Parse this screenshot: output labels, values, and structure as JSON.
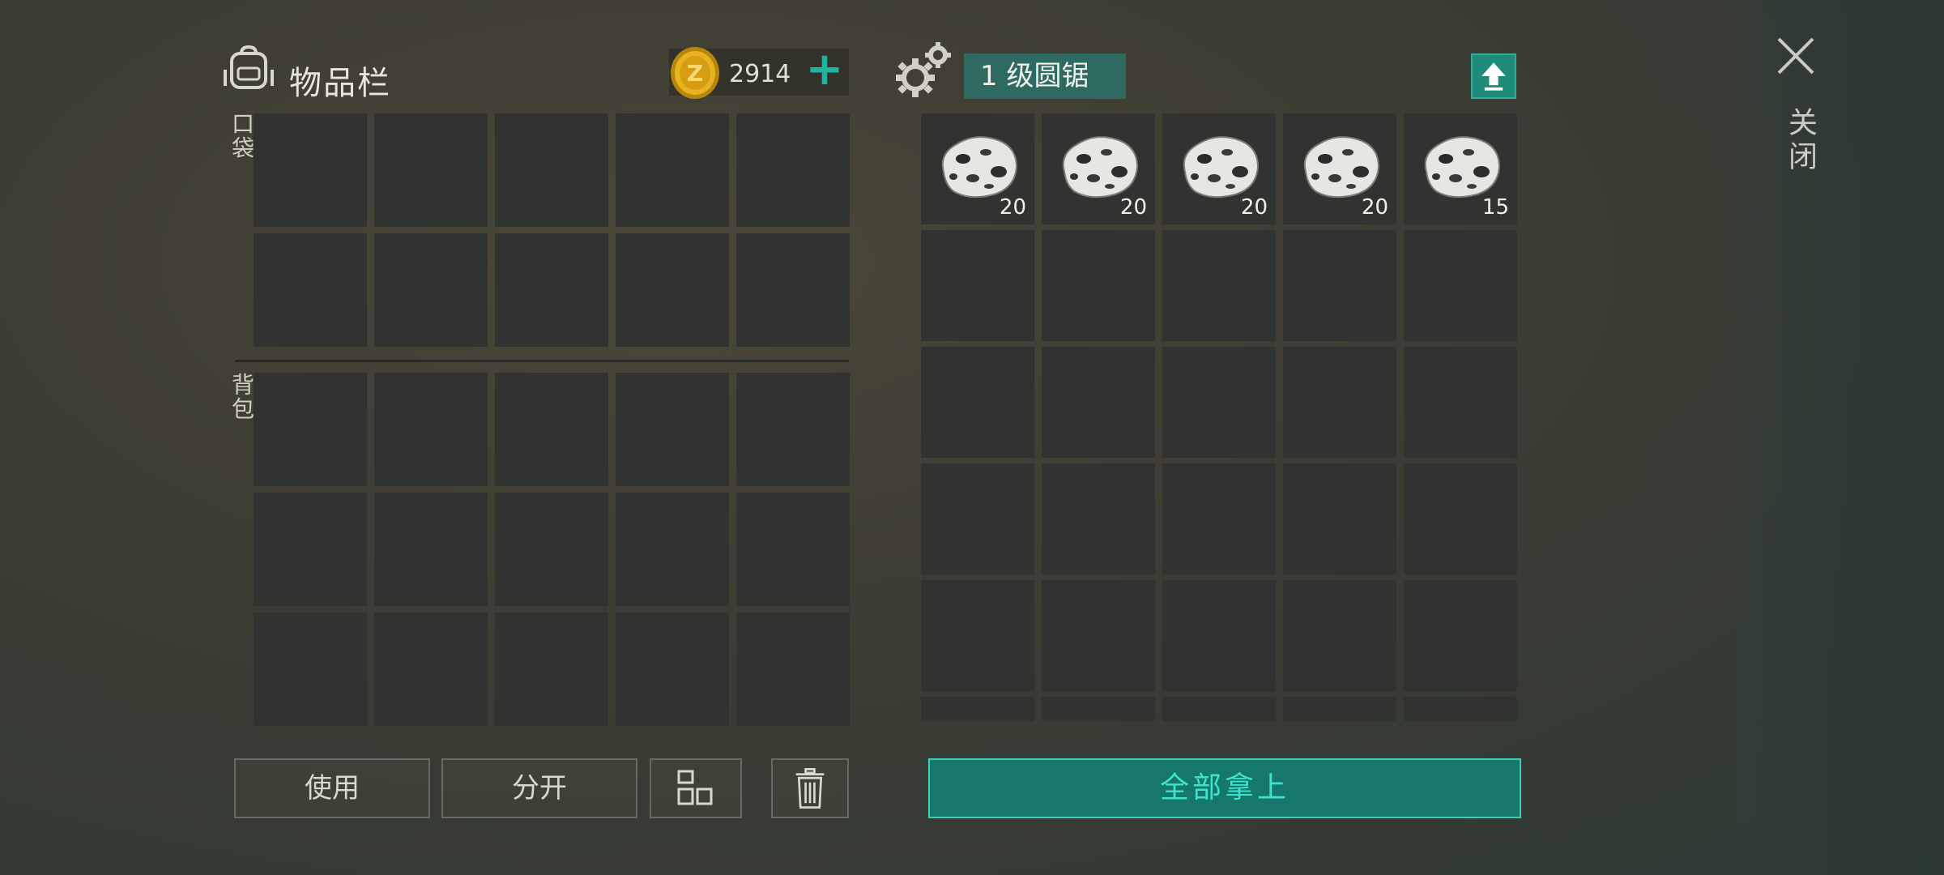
{
  "inventory": {
    "title": "物品栏",
    "coins": "2914",
    "plus_label": "+",
    "pocket_label": "口袋",
    "backpack_label": "背包"
  },
  "station": {
    "title": "1 级圆锯",
    "items": [
      {
        "name": "stone",
        "qty": "20"
      },
      {
        "name": "stone",
        "qty": "20"
      },
      {
        "name": "stone",
        "qty": "20"
      },
      {
        "name": "stone",
        "qty": "20"
      },
      {
        "name": "stone",
        "qty": "15"
      }
    ]
  },
  "buttons": {
    "use": "使用",
    "split": "分开",
    "take_all": "全部拿上",
    "close": "关闭"
  },
  "icons": {
    "bag": "backpack-icon",
    "coin": "coin-icon",
    "gears": "gears-icon",
    "upgrade": "arrow-up-icon",
    "sort": "sort-grid-icon",
    "trash": "trash-icon",
    "close": "close-icon"
  },
  "colors": {
    "accent": "#16776b",
    "accent_text": "#3fe2cb",
    "cell": "#313330",
    "plus": "#1fb3a2"
  }
}
